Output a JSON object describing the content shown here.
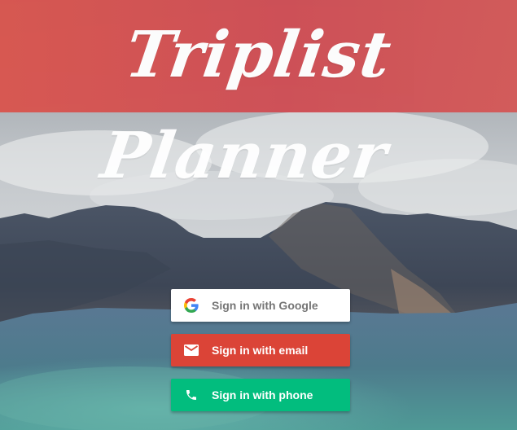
{
  "header": {
    "title": "Triplist Planner",
    "color": "#d9564f"
  },
  "auth": {
    "google": {
      "label": "Sign in with Google",
      "icon": "google-logo-icon",
      "color": "#ffffff"
    },
    "email": {
      "label": "Sign in with email",
      "icon": "mail-icon",
      "color": "#db4437"
    },
    "phone": {
      "label": "Sign in with phone",
      "icon": "phone-icon",
      "color": "#02bd7e"
    }
  }
}
